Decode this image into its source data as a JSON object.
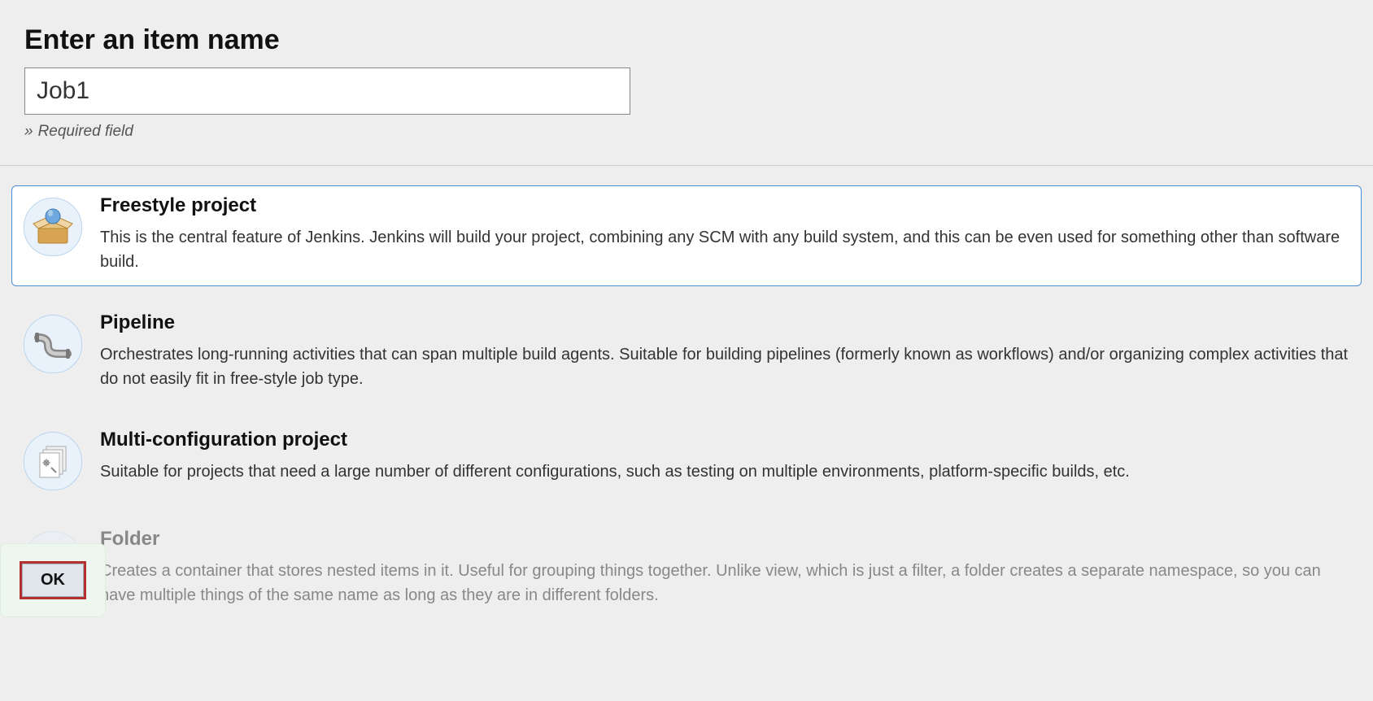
{
  "header": {
    "title": "Enter an item name",
    "input_value": "Job1",
    "required_note": "Required field"
  },
  "items": [
    {
      "id": "freestyle",
      "label": "Freestyle project",
      "desc": "This is the central feature of Jenkins. Jenkins will build your project, combining any SCM with any build system, and this can be even used for something other than software build.",
      "selected": true
    },
    {
      "id": "pipeline",
      "label": "Pipeline",
      "desc": "Orchestrates long-running activities that can span multiple build agents. Suitable for building pipelines (formerly known as workflows) and/or organizing complex activities that do not easily fit in free-style job type.",
      "selected": false
    },
    {
      "id": "multiconfig",
      "label": "Multi-configuration project",
      "desc": "Suitable for projects that need a large number of different configurations, such as testing on multiple environments, platform-specific builds, etc.",
      "selected": false
    },
    {
      "id": "folder",
      "label": "Folder",
      "desc": "Creates a container that stores nested items in it. Useful for grouping things together. Unlike view, which is just a filter, a folder creates a separate namespace, so you can have multiple things of the same name as long as they are in different folders.",
      "selected": false,
      "faded": true
    }
  ],
  "actions": {
    "ok_label": "OK"
  }
}
